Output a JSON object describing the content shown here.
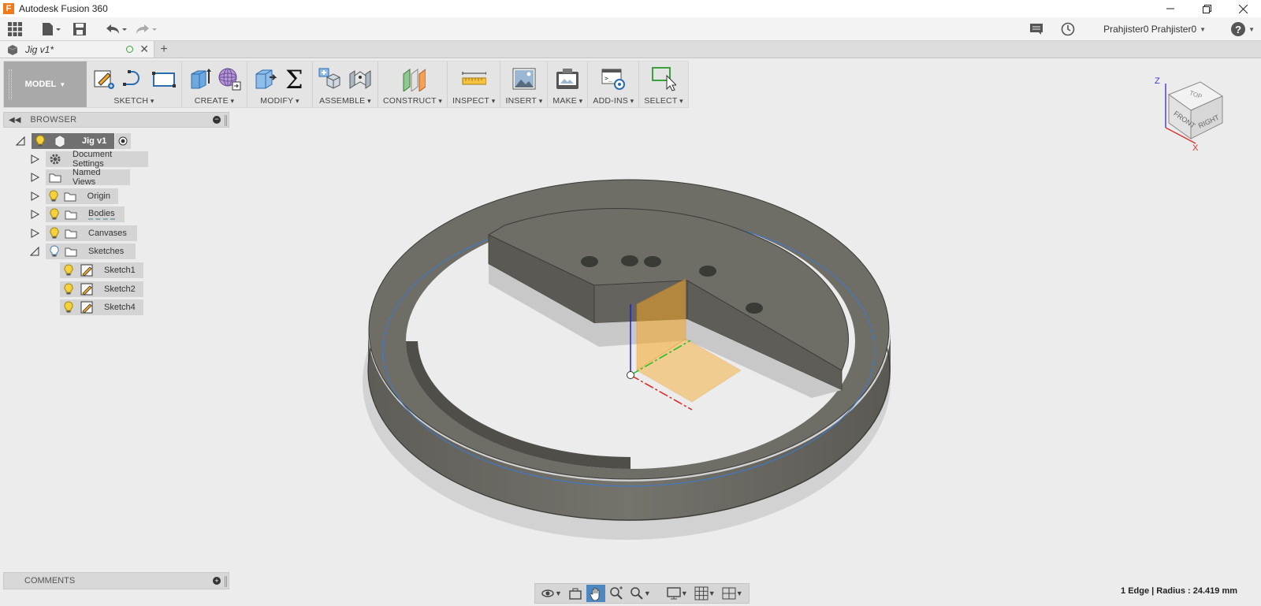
{
  "window": {
    "title": "Autodesk Fusion 360",
    "logo_letter": "F"
  },
  "quick_access": {
    "user": "Prahjister0 Prahjister0",
    "help": "?"
  },
  "tabs": [
    {
      "label": "Jig v1*"
    }
  ],
  "ribbon": {
    "workspace": "MODEL",
    "groups": [
      {
        "label": "SKETCH"
      },
      {
        "label": "CREATE"
      },
      {
        "label": "MODIFY"
      },
      {
        "label": "ASSEMBLE"
      },
      {
        "label": "CONSTRUCT"
      },
      {
        "label": "INSPECT"
      },
      {
        "label": "INSERT"
      },
      {
        "label": "MAKE"
      },
      {
        "label": "ADD-INS"
      },
      {
        "label": "SELECT"
      }
    ]
  },
  "browser": {
    "title": "BROWSER",
    "root": "Jig v1",
    "items": [
      {
        "label": "Document Settings"
      },
      {
        "label": "Named Views"
      },
      {
        "label": "Origin"
      },
      {
        "label": "Bodies"
      },
      {
        "label": "Canvases"
      },
      {
        "label": "Sketches"
      }
    ],
    "sketches": [
      {
        "label": "Sketch1"
      },
      {
        "label": "Sketch2"
      },
      {
        "label": "Sketch4"
      }
    ]
  },
  "viewcube": {
    "top": "TOP",
    "front": "FRONT",
    "right": "RIGHT",
    "axis_z": "Z",
    "axis_x": "X"
  },
  "comments": {
    "title": "COMMENTS"
  },
  "status": {
    "text": "1 Edge | Radius : 24.419 mm"
  },
  "colors": {
    "model": "#6b6a63",
    "plane": "#f5a623",
    "axis_x": "#e02020",
    "axis_y": "#20c020",
    "axis_z": "#2020d0",
    "active_nav": "#4e88c0"
  }
}
